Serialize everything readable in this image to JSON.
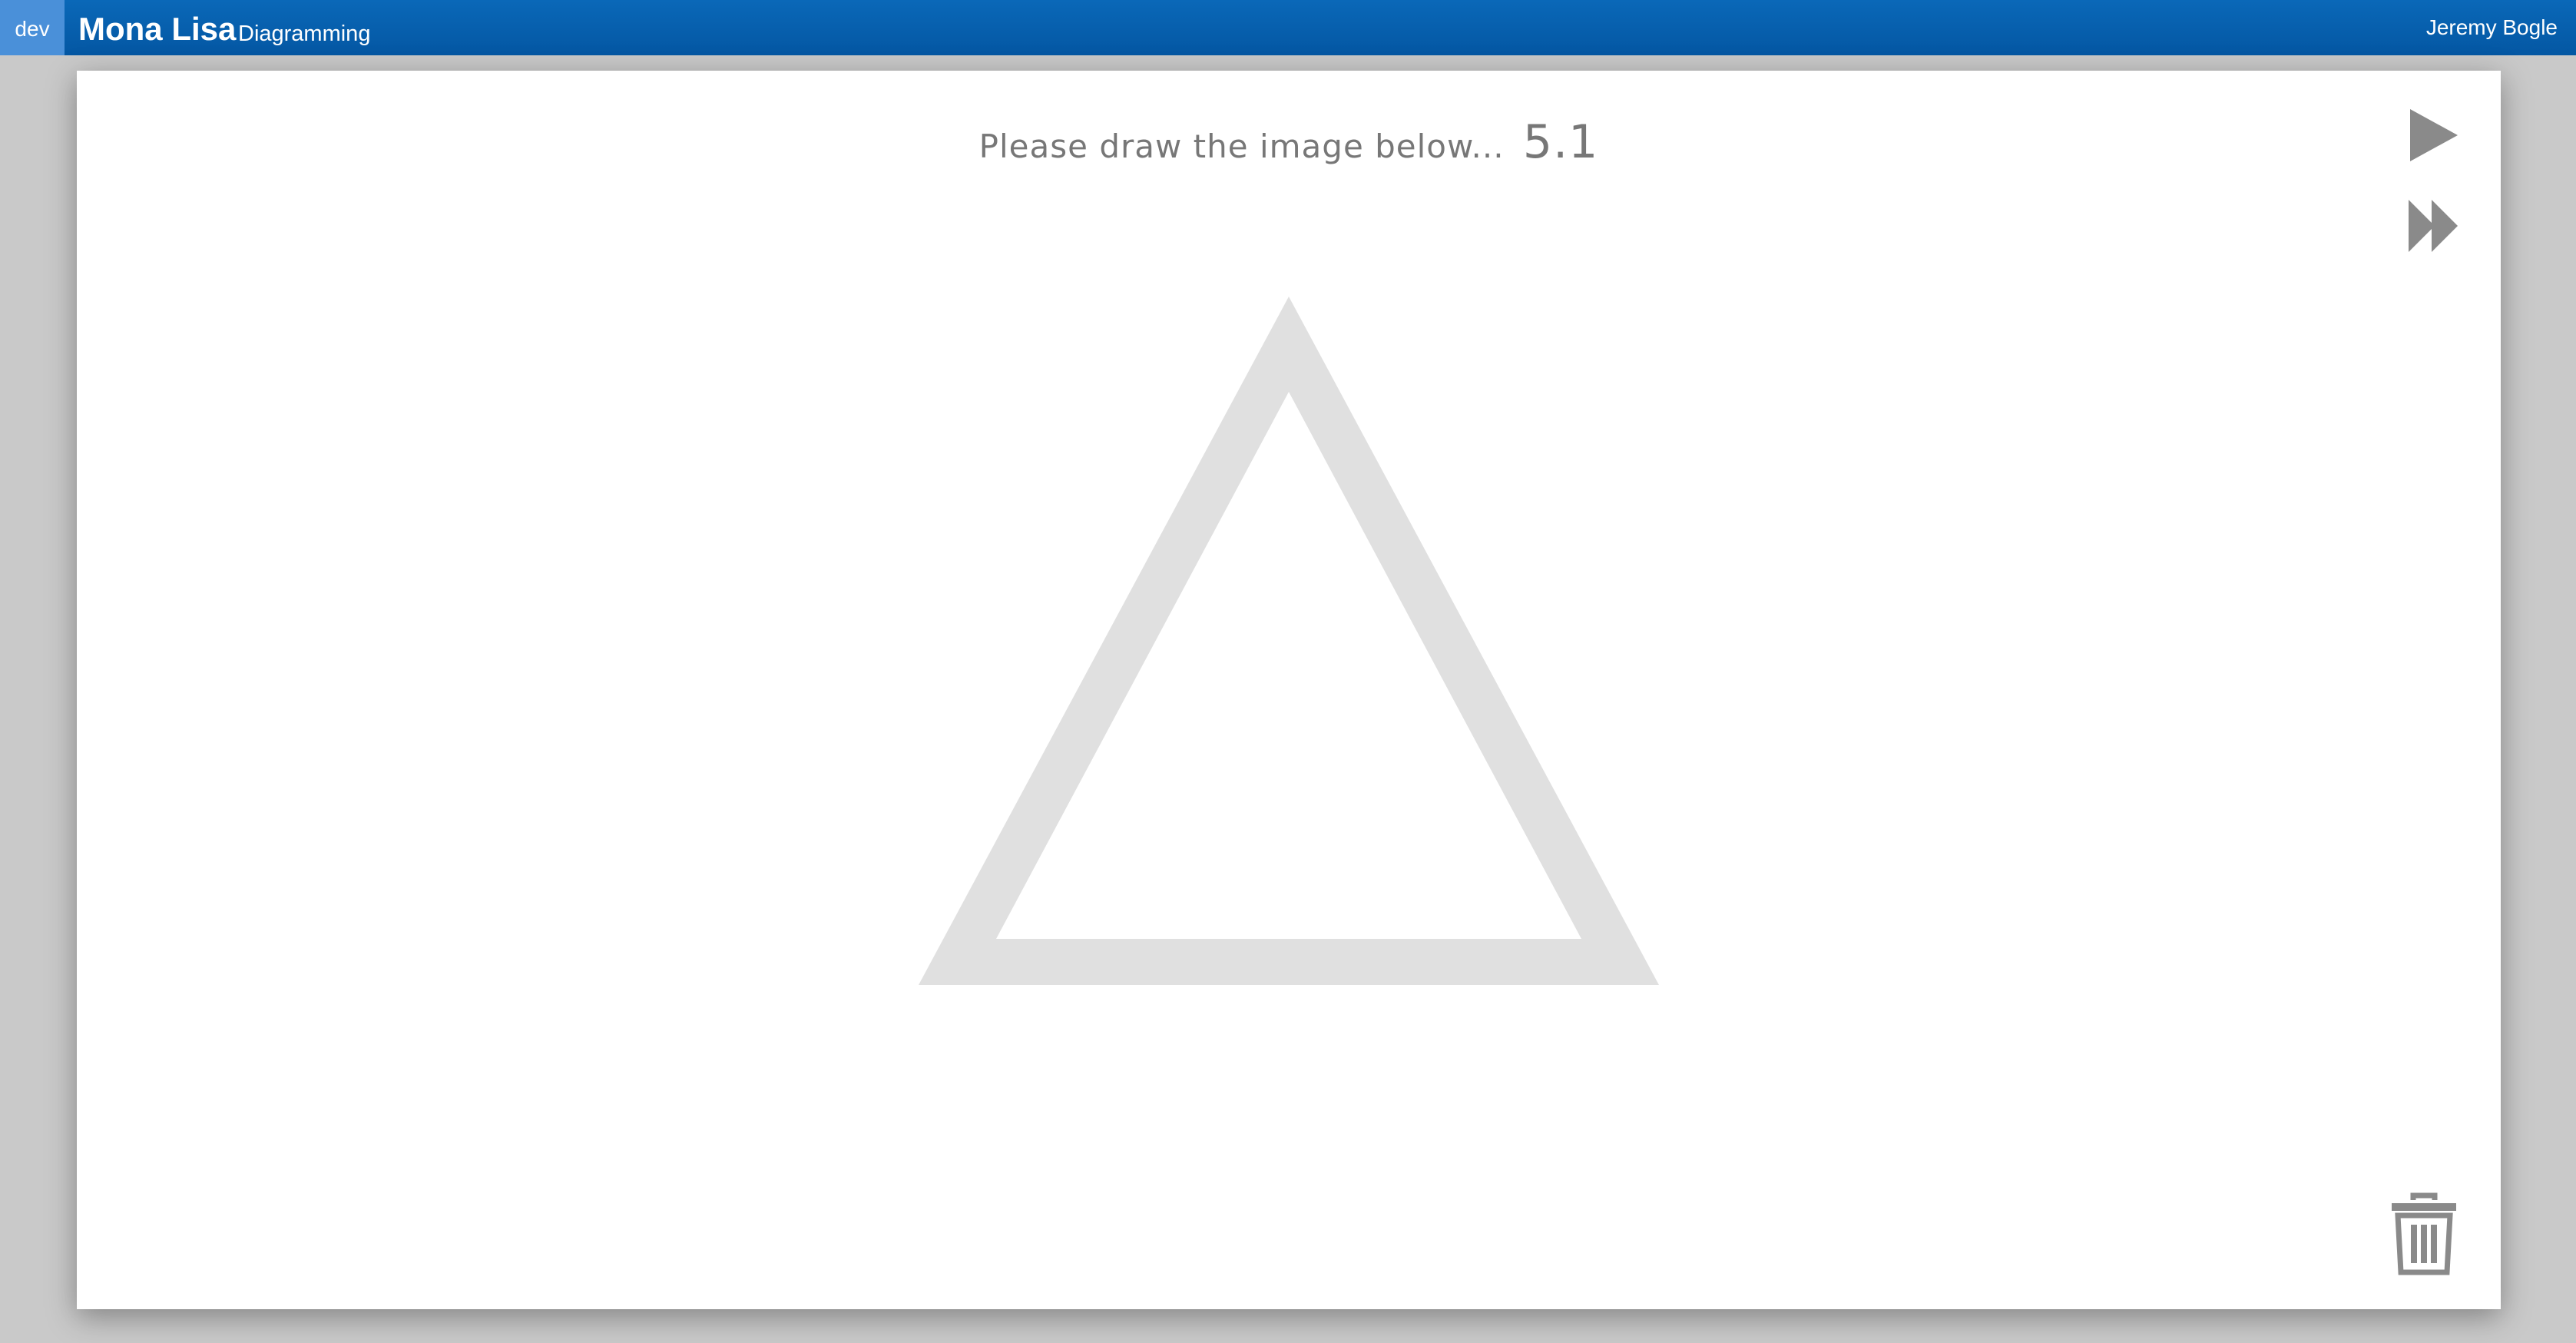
{
  "header": {
    "env_badge": "dev",
    "app_name": "Mona Lisa",
    "app_section": "Diagramming",
    "user_name": "Jeremy Bogle"
  },
  "main": {
    "prompt_text": "Please draw the image below...",
    "version": "5.1",
    "target_shape": "triangle-outline",
    "shape_color": "#e0e0e0"
  },
  "controls": {
    "play_icon": "play-icon",
    "fast_forward_icon": "fast-forward-icon",
    "trash_icon": "trash-icon",
    "icon_color": "#8a8a8a"
  },
  "colors": {
    "header_bg": "#0a5fae",
    "env_badge_bg": "#4a90d9",
    "page_bg": "#c9c9c9"
  }
}
